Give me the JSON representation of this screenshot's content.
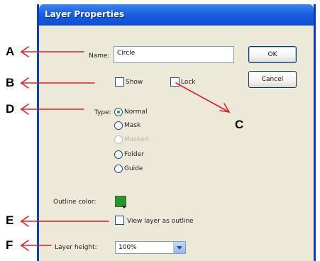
{
  "dialog": {
    "title": "Layer Properties",
    "name_label": "Name:",
    "name_value": "Circle",
    "ok_label": "OK",
    "cancel_label": "Cancel",
    "show_label": "Show",
    "lock_label": "Lock",
    "type_label": "Type:",
    "type_options": [
      "Normal",
      "Mask",
      "Masked",
      "Folder",
      "Guide"
    ],
    "selected_type": "Normal",
    "outline_color_label": "Outline color:",
    "outline_color": "#1f9a2a",
    "view_outline_label": "View layer as outline",
    "layer_height_label": "Layer height:",
    "layer_height_value": "100%"
  },
  "callouts": [
    "A",
    "B",
    "C",
    "D",
    "E",
    "F"
  ],
  "colors": {
    "title_bar": "#0d4fd1",
    "arrow": "#e02020"
  }
}
